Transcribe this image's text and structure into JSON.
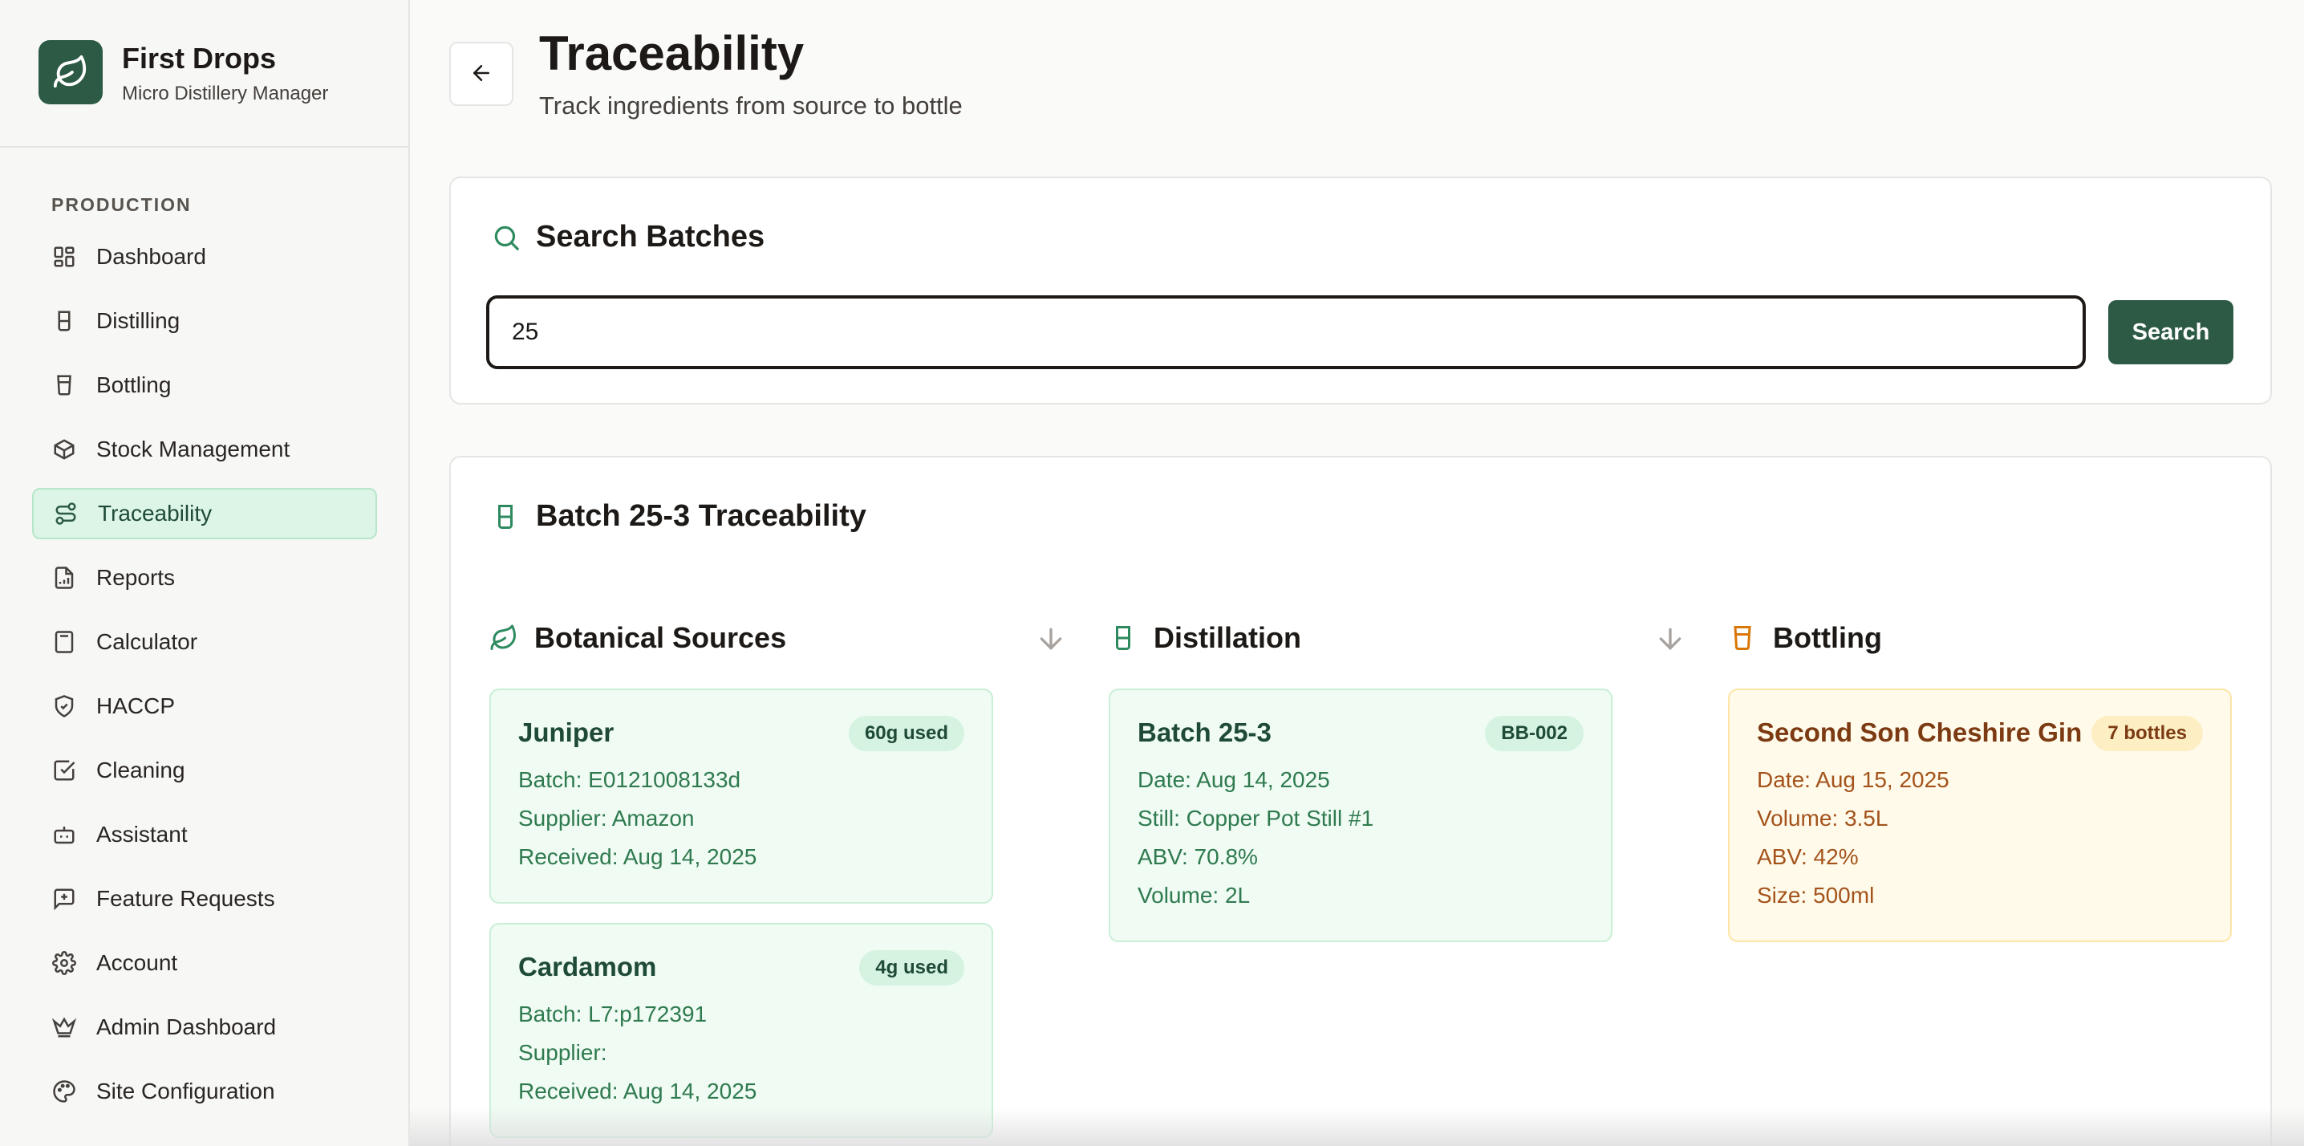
{
  "brand": {
    "name": "First Drops",
    "subtitle": "Micro Distillery Manager"
  },
  "nav": {
    "section": "PRODUCTION",
    "items": [
      {
        "label": "Dashboard",
        "icon": "grid-icon"
      },
      {
        "label": "Distilling",
        "icon": "beaker-icon"
      },
      {
        "label": "Bottling",
        "icon": "bottle-icon"
      },
      {
        "label": "Stock Management",
        "icon": "box-icon"
      },
      {
        "label": "Traceability",
        "icon": "route-icon",
        "active": true
      },
      {
        "label": "Reports",
        "icon": "report-icon"
      },
      {
        "label": "Calculator",
        "icon": "calculator-icon"
      },
      {
        "label": "HACCP",
        "icon": "shield-check-icon"
      },
      {
        "label": "Cleaning",
        "icon": "checkbox-icon"
      },
      {
        "label": "Assistant",
        "icon": "bot-icon"
      },
      {
        "label": "Feature Requests",
        "icon": "message-plus-icon"
      },
      {
        "label": "Account",
        "icon": "gear-icon"
      },
      {
        "label": "Admin Dashboard",
        "icon": "crown-icon"
      },
      {
        "label": "Site Configuration",
        "icon": "palette-icon"
      }
    ]
  },
  "header": {
    "title": "Traceability",
    "subtitle": "Track ingredients from source to bottle"
  },
  "search": {
    "title": "Search Batches",
    "value": "25",
    "button": "Search"
  },
  "trace": {
    "title": "Batch 25-3 Traceability",
    "columns": {
      "botanical": "Botanical Sources",
      "distillation": "Distillation",
      "bottling": "Bottling"
    },
    "botanicals": [
      {
        "name": "Juniper",
        "badge": "60g used",
        "batch": "Batch: E0121008133d",
        "supplier": "Supplier: Amazon",
        "received": "Received: Aug 14, 2025"
      },
      {
        "name": "Cardamom",
        "badge": "4g used",
        "batch": "Batch: L7:p172391",
        "supplier": "Supplier:",
        "received": "Received: Aug 14, 2025"
      }
    ],
    "distillation": {
      "name": "Batch 25-3",
      "badge": "BB-002",
      "date": "Date: Aug 14, 2025",
      "still": "Still: Copper Pot Still #1",
      "abv": "ABV: 70.8%",
      "volume": "Volume: 2L"
    },
    "bottling": {
      "name": "Second Son Cheshire Gin",
      "badge": "7 bottles",
      "date": "Date: Aug 15, 2025",
      "volume": "Volume: 3.5L",
      "abv": "ABV: 42%",
      "size": "Size: 500ml"
    }
  },
  "colors": {
    "accent": "#2d5a45",
    "active_bg": "#dcf5e7",
    "green_card": "#effbf3",
    "amber_card": "#fffaea",
    "amber_icon": "#d97706"
  }
}
